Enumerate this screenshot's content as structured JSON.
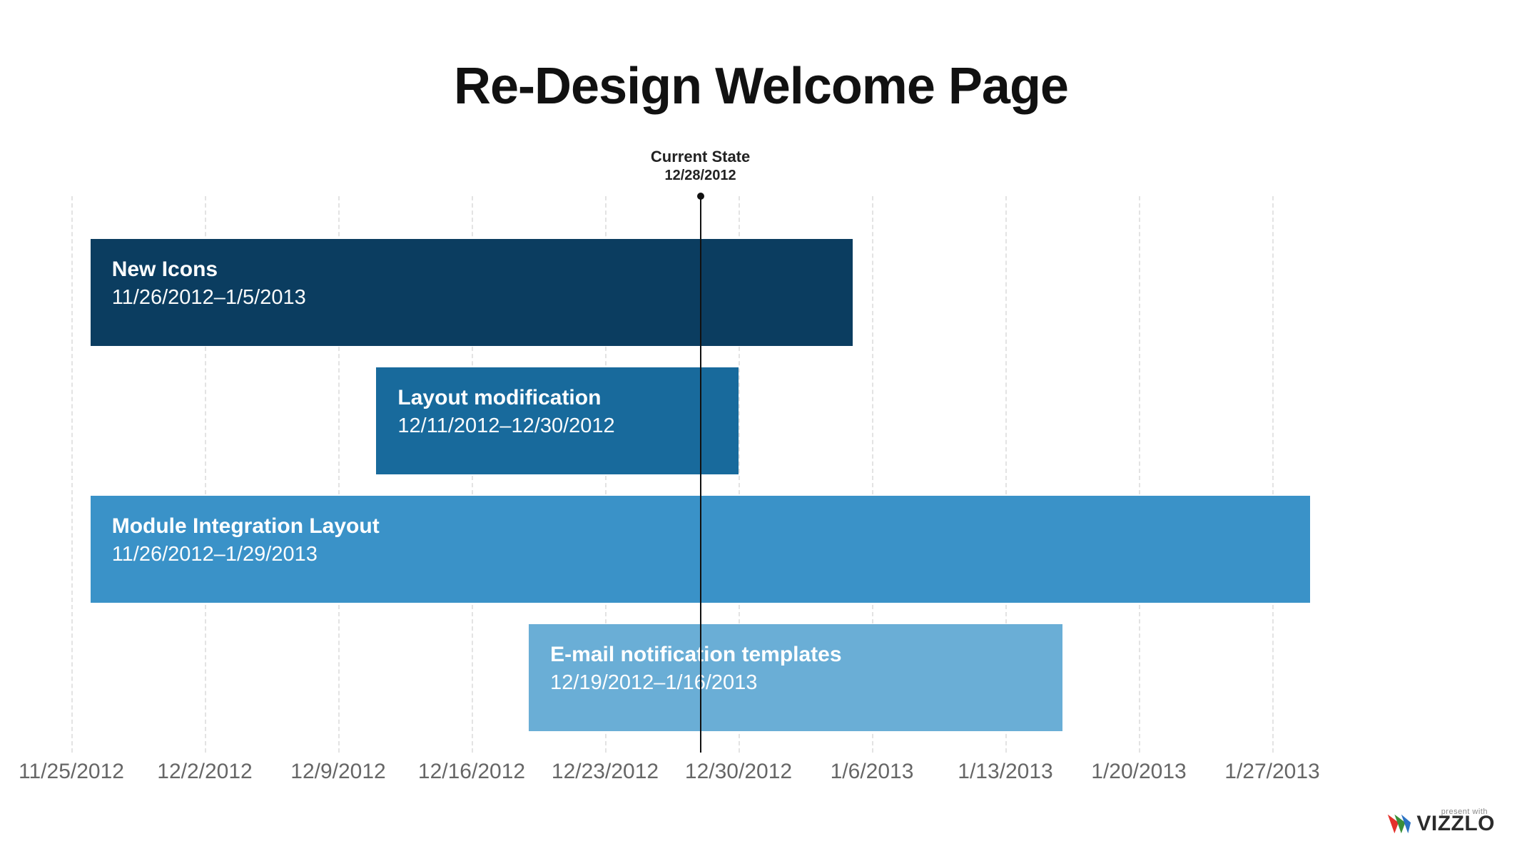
{
  "chart_data": {
    "type": "bar",
    "title": "Re-Design Welcome Page",
    "orientation": "horizontal-gantt",
    "x_axis": {
      "type": "date",
      "min": "2012-11-25",
      "max": "2013-02-03",
      "tick_interval_days": 7,
      "ticks": [
        "11/25/2012",
        "12/2/2012",
        "12/9/2012",
        "12/16/2012",
        "12/23/2012",
        "12/30/2012",
        "1/6/2013",
        "1/13/2013",
        "1/20/2013",
        "1/27/2013"
      ]
    },
    "marker": {
      "label": "Current State",
      "date_label": "12/28/2012",
      "date": "2012-12-28"
    },
    "tasks": [
      {
        "name": "New Icons",
        "range_label": "11/26/2012–1/5/2013",
        "start": "2012-11-26",
        "end": "2013-01-05",
        "color": "#0b3d60"
      },
      {
        "name": "Layout modification",
        "range_label": "12/11/2012–12/30/2012",
        "start": "2012-12-11",
        "end": "2012-12-30",
        "color": "#186a9c"
      },
      {
        "name": "Module Integration Layout",
        "range_label": "11/26/2012–1/29/2013",
        "start": "2012-11-26",
        "end": "2013-01-29",
        "color": "#3a92c8"
      },
      {
        "name": "E-mail notification templates",
        "range_label": "12/19/2012–1/16/2013",
        "start": "2012-12-19",
        "end": "2013-01-16",
        "color": "#6aaed6"
      }
    ]
  },
  "branding": {
    "name": "VIZZLO",
    "tagline": "present with"
  }
}
